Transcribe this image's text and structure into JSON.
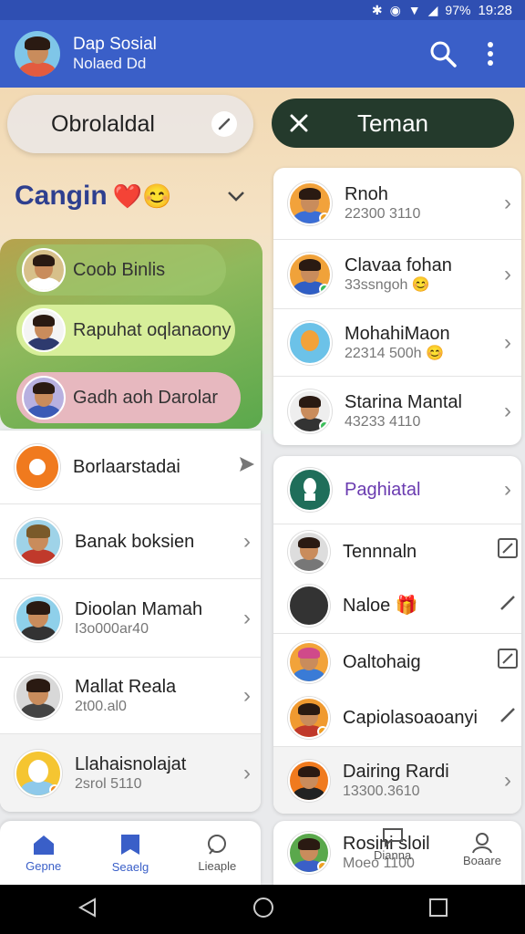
{
  "status_bar": {
    "time": "19:28",
    "battery": "97%"
  },
  "app_bar": {
    "title": "Dap Sosial",
    "subtitle": "Nolaed Dd",
    "search_icon": "search-icon",
    "menu_icon": "more-vert-icon",
    "brand_color": "#3a5fc8"
  },
  "tabs": {
    "left_label": "Obrolaldal",
    "right_label": "Teman"
  },
  "section": {
    "title": "Cangin",
    "emoji": "❤️😊"
  },
  "featured": [
    {
      "label": "Coob Binlis"
    },
    {
      "label": "Rapuhat oqlanaony"
    },
    {
      "label": "Gadh aoh Darolar"
    }
  ],
  "left_list": [
    {
      "name": "Borlaarstadai",
      "sub": ""
    },
    {
      "name": "Banak boksien",
      "sub": ""
    },
    {
      "name": "Dioolan Mamah",
      "sub": "I3o000ar40"
    },
    {
      "name": "Mallat Reala",
      "sub": "2t00.al0"
    },
    {
      "name": "Llahaisnolajat",
      "sub": "2srol 5110"
    }
  ],
  "right_list_top": [
    {
      "name": "Rnoh",
      "sub": "22300 3110"
    },
    {
      "name": "Clavaa fohan",
      "sub": "33ssngoh"
    },
    {
      "name": "MohahiMaon",
      "sub": "22314 500h"
    },
    {
      "name": "Starina Mantal",
      "sub": "43233 4110"
    }
  ],
  "right_list_bottom": [
    {
      "name": "Paghiatal",
      "sub": ""
    },
    {
      "name": "Tennnaln",
      "sub": ""
    },
    {
      "name": "Naloe",
      "sub": ""
    },
    {
      "name": "Oaltohaig",
      "sub": ""
    },
    {
      "name": "Capiolasoaoanyi",
      "sub": ""
    },
    {
      "name": "Dairing Rardi",
      "sub": "13300.3610"
    },
    {
      "name": "Rosini",
      "sub": "Moeo"
    }
  ],
  "bottom_nav": [
    {
      "label": "Gepne"
    },
    {
      "label": "Seaelg"
    },
    {
      "label": "Lieaple"
    },
    {
      "label": "Dianna"
    },
    {
      "label": "Boaare"
    }
  ],
  "right_overlap_labels": {
    "stoil": "sloil",
    "num": "1100"
  }
}
